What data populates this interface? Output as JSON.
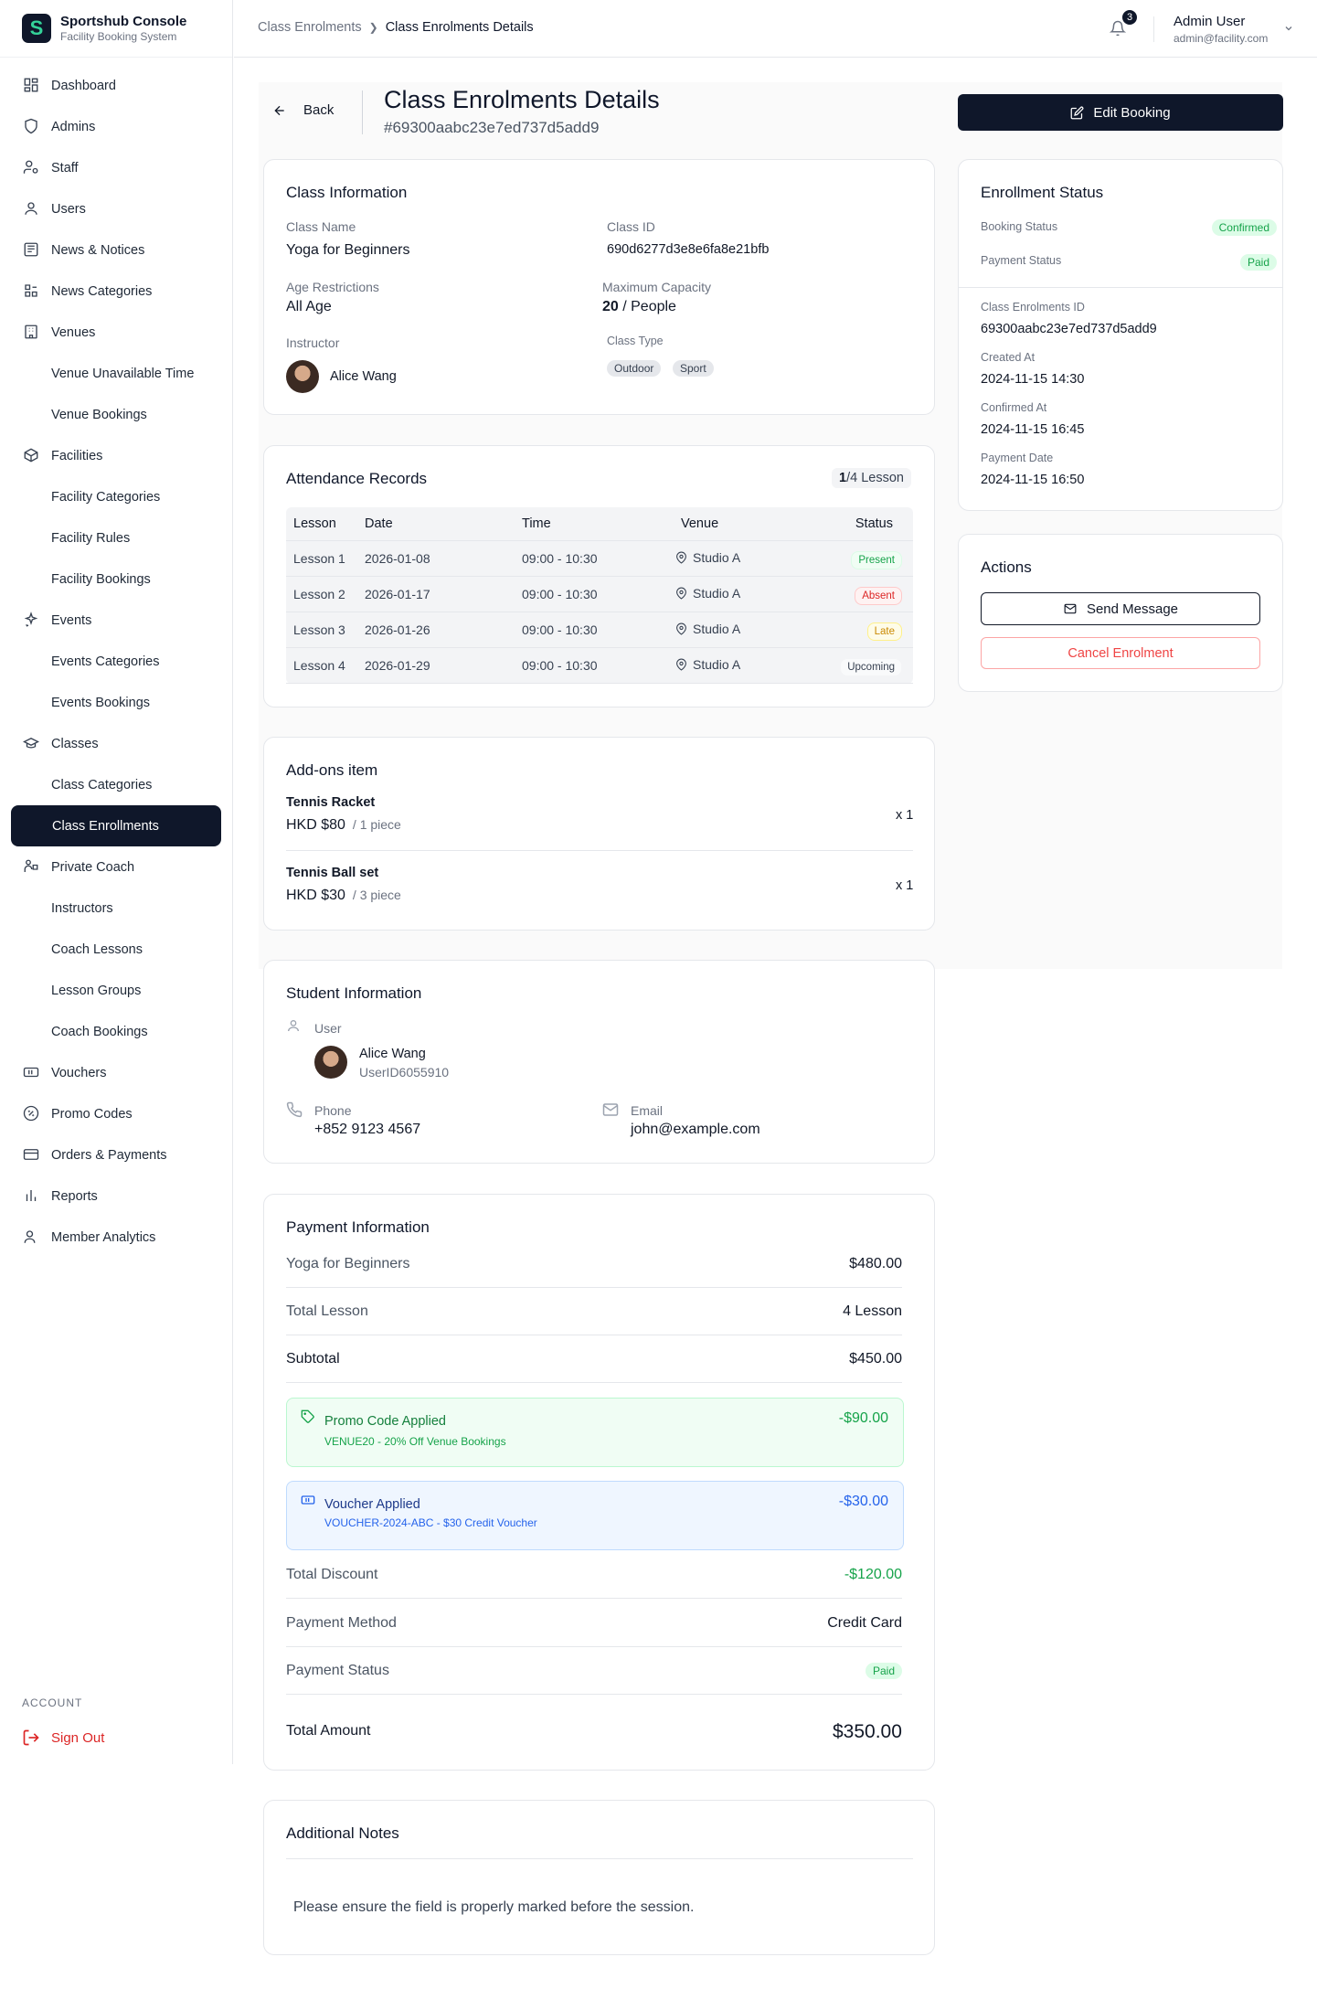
{
  "brand": {
    "title": "Sportshub Console",
    "subtitle": "Facility Booking System",
    "logo": "S"
  },
  "nav": [
    {
      "label": "Dashboard",
      "icon": "dashboard-icon"
    },
    {
      "label": "Admins",
      "icon": "shield-icon"
    },
    {
      "label": "Staff",
      "icon": "staff-icon"
    },
    {
      "label": "Users",
      "icon": "users-icon"
    },
    {
      "label": "News & Notices",
      "icon": "newspaper-icon"
    },
    {
      "label": "News Categories",
      "icon": "categories-icon"
    },
    {
      "label": "Venues",
      "icon": "building-icon"
    },
    {
      "label": "Venue Unavailable Time",
      "icon": ""
    },
    {
      "label": "Venue Bookings",
      "icon": ""
    },
    {
      "label": "Facilities",
      "icon": "box-icon"
    },
    {
      "label": "Facility Categories",
      "icon": ""
    },
    {
      "label": "Facility Rules",
      "icon": ""
    },
    {
      "label": "Facility Bookings",
      "icon": ""
    },
    {
      "label": "Events",
      "icon": "sparkle-icon"
    },
    {
      "label": "Events Categories",
      "icon": ""
    },
    {
      "label": "Events Bookings",
      "icon": ""
    },
    {
      "label": "Classes",
      "icon": "graduation-cap-icon"
    },
    {
      "label": "Class Categories",
      "icon": ""
    },
    {
      "label": "Class Enrollments",
      "icon": ""
    },
    {
      "label": "Private Coach",
      "icon": "coach-icon"
    },
    {
      "label": "Instructors",
      "icon": ""
    },
    {
      "label": "Coach Lessons",
      "icon": ""
    },
    {
      "label": "Lesson Groups",
      "icon": ""
    },
    {
      "label": "Coach Bookings",
      "icon": ""
    },
    {
      "label": "Vouchers",
      "icon": "ticket-icon"
    },
    {
      "label": "Promo Codes",
      "icon": "percent-icon"
    },
    {
      "label": "Orders & Payments",
      "icon": "credit-card-icon"
    },
    {
      "label": "Reports",
      "icon": "bar-chart-icon"
    },
    {
      "label": "Member Analytics",
      "icon": "user-chart-icon"
    }
  ],
  "account": {
    "heading": "ACCOUNT",
    "signout": "Sign Out"
  },
  "header": {
    "breadcrumb": [
      "Class Enrolments",
      "Class Enrolments Details"
    ],
    "notifications": "3",
    "user_name": "Admin User",
    "user_email": "admin@facility.com"
  },
  "page": {
    "back": "Back",
    "title": "Class Enrolments Details",
    "id": "#69300aabc23e7ed737d5add9",
    "edit": "Edit Booking"
  },
  "class_info": {
    "heading": "Class Information",
    "name_label": "Class Name",
    "name": "Yoga for Beginners",
    "id_label": "Class ID",
    "id": "690d6277d3e8e6fa8e21bfb",
    "age_label": "Age Restrictions",
    "age": "All Age",
    "cap_label": "Maximum Capacity",
    "cap_num": "20",
    "cap_unit": " / People",
    "instructor_label": "Instructor",
    "instructor": "Alice Wang",
    "type_label": "Class Type",
    "types": [
      "Outdoor",
      "Sport"
    ]
  },
  "attendance": {
    "heading": "Attendance Records",
    "count_done": "1",
    "count_rest": "/4 Lesson",
    "columns": [
      "Lesson",
      "Date",
      "Time",
      "Venue",
      "Status"
    ],
    "rows": [
      {
        "lesson": "Lesson 1",
        "date": "2026-01-08",
        "time": "09:00 - 10:30",
        "venue": "Studio A",
        "status": "Present"
      },
      {
        "lesson": "Lesson 2",
        "date": "2026-01-17",
        "time": "09:00 - 10:30",
        "venue": "Studio A",
        "status": "Absent"
      },
      {
        "lesson": "Lesson 3",
        "date": "2026-01-26",
        "time": "09:00 - 10:30",
        "venue": "Studio A",
        "status": "Late"
      },
      {
        "lesson": "Lesson 4",
        "date": "2026-01-29",
        "time": "09:00 - 10:30",
        "venue": "Studio A",
        "status": "Upcoming"
      }
    ]
  },
  "addons": {
    "heading": "Add-ons item",
    "items": [
      {
        "name": "Tennis Racket",
        "price": "HKD $80",
        "unit": "/ 1 piece",
        "qty": "x 1"
      },
      {
        "name": "Tennis Ball set",
        "price": "HKD $30",
        "unit": "/ 3 piece",
        "qty": "x 1"
      }
    ]
  },
  "student": {
    "heading": "Student Information",
    "user_label": "User",
    "name": "Alice Wang",
    "user_id": "UserID6055910",
    "phone_label": "Phone",
    "phone": "+852 9123 4567",
    "email_label": "Email",
    "email": "john@example.com"
  },
  "payment": {
    "heading": "Payment Information",
    "course": "Yoga for Beginners",
    "course_price": "$480.00",
    "lessons_label": "Total Lesson",
    "lessons": "4 Lesson",
    "subtotal_label": "Subtotal",
    "subtotal": "$450.00",
    "promo_title": "Promo Code Applied",
    "promo_desc": "VENUE20 - 20% Off Venue Bookings",
    "promo_amount": "-$90.00",
    "voucher_title": "Voucher Applied",
    "voucher_desc": "VOUCHER-2024-ABC - $30 Credit Voucher",
    "voucher_amount": "-$30.00",
    "discount_label": "Total Discount",
    "discount": "-$120.00",
    "method_label": "Payment Method",
    "method": "Credit Card",
    "status_label": "Payment Status",
    "status": "Paid",
    "total_label": "Total Amount",
    "total": "$350.00"
  },
  "notes": {
    "heading": "Additional Notes",
    "text": "Please ensure the field is properly marked before the session."
  },
  "enrollment": {
    "heading": "Enrollment Status",
    "booking_label": "Booking Status",
    "booking": "Confirmed",
    "payment_label": "Payment Status",
    "payment": "Paid",
    "id_label": "Class Enrolments ID",
    "id": "69300aabc23e7ed737d5add9",
    "created_label": "Created At",
    "created": "2024-11-15 14:30",
    "confirmed_label": "Confirmed At",
    "confirmed": "2024-11-15 16:45",
    "paid_label": "Payment Date",
    "paid": "2024-11-15 16:50"
  },
  "actions": {
    "heading": "Actions",
    "send": "Send Message",
    "cancel": "Cancel Enrolment"
  },
  "colors": {
    "primary": "#0f172a",
    "success": "#16a34a",
    "danger": "#dc2626",
    "warning": "#ca8a04",
    "info": "#2563eb"
  }
}
